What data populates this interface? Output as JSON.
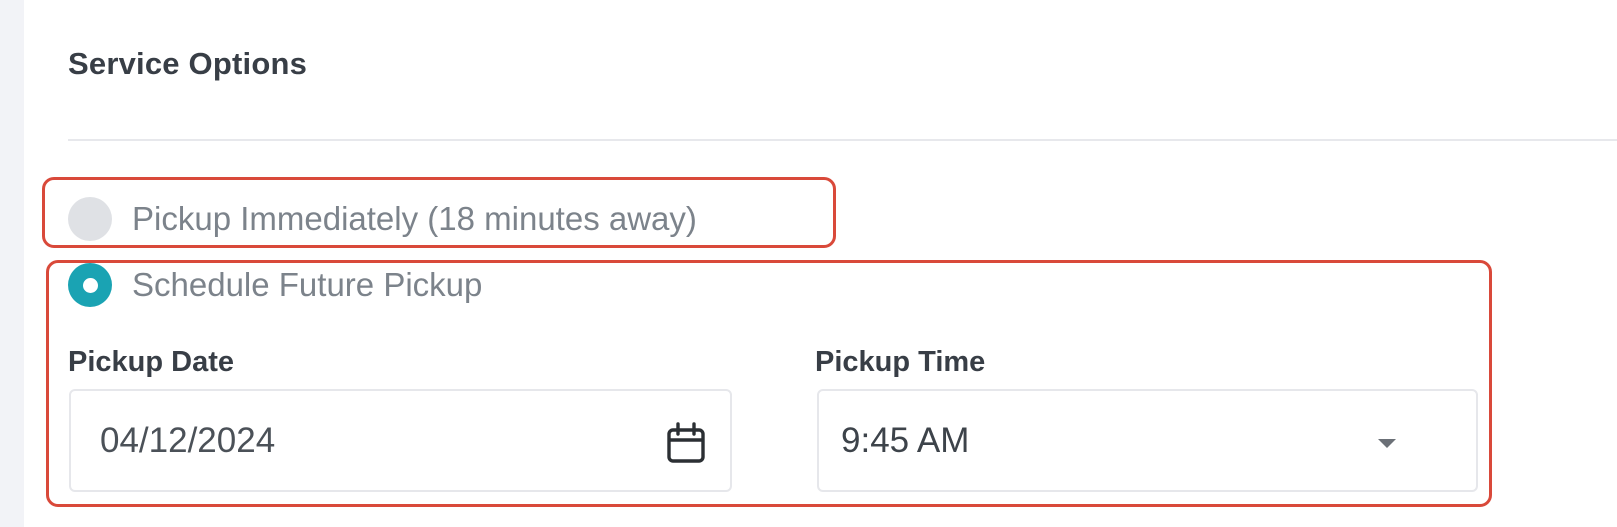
{
  "section": {
    "title": "Service Options"
  },
  "options": {
    "immediate_label": "Pickup Immediately (18 minutes away)",
    "immediate_selected": false,
    "future_label": "Schedule Future Pickup",
    "future_selected": true
  },
  "pickup_date": {
    "label": "Pickup Date",
    "value": "04/12/2024",
    "icon": "calendar-icon"
  },
  "pickup_time": {
    "label": "Pickup Time",
    "value": "9:45 AM",
    "icon": "chevron-down-icon"
  },
  "colors": {
    "accent": "#1aa3b3",
    "highlight": "#d9493a",
    "radio_unselected": "#dfe1e5"
  }
}
